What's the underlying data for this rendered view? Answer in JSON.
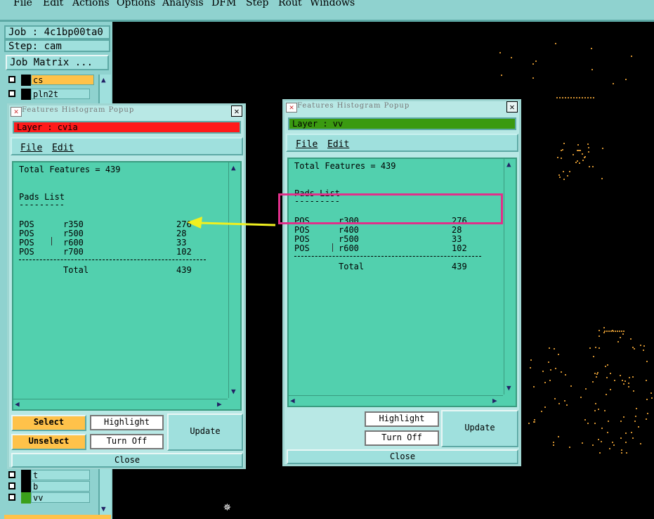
{
  "menubar": {
    "items": [
      "File",
      "Edit",
      "Actions",
      "Options",
      "Analysis",
      "DFM",
      "Step",
      "Rout",
      "Windows"
    ]
  },
  "leftpanel": {
    "job": "Job : 4c1bp00ta0",
    "step": "Step: cam",
    "job_matrix": "Job Matrix ...",
    "layers_top": [
      {
        "name": "cs",
        "color": "#ffc24a"
      },
      {
        "name": "pln2t",
        "color": "#9fe0dd"
      }
    ],
    "layers_bottom": [
      {
        "name": "t",
        "color": "#9fe0dd",
        "swatch": "#000000"
      },
      {
        "name": "b",
        "color": "#9fe0dd",
        "swatch": "#000000"
      },
      {
        "name": "vv",
        "color": "#9fe0dd",
        "swatch": "#3aa01a"
      }
    ]
  },
  "popup_left": {
    "title": "Features Histogram Popup",
    "layer_label": "Layer :  cvia",
    "layer_color": "#ff1a1a",
    "menu": {
      "file": "File",
      "edit": "Edit"
    },
    "total": "Total Features = 439",
    "list_title": "Pads List",
    "list_underline": "---------",
    "rows": [
      {
        "type": "POS",
        "sym": "r350",
        "count": "276"
      },
      {
        "type": "POS",
        "sym": "r500",
        "count": "28"
      },
      {
        "type": "POS",
        "sym": "r600",
        "count": "33"
      },
      {
        "type": "POS",
        "sym": "r700",
        "count": "102"
      }
    ],
    "total_label": "Total",
    "total_value": "439",
    "buttons": {
      "select": "Select",
      "unselect": "Unselect",
      "highlight": "Highlight",
      "turn_off": "Turn Off",
      "update": "Update",
      "close": "Close"
    }
  },
  "popup_right": {
    "title": "Features Histogram Popup",
    "layer_label": "Layer :  vv",
    "layer_color": "#3a9a10",
    "menu": {
      "file": "File",
      "edit": "Edit"
    },
    "total": "Total Features = 439",
    "list_title": "Pads List",
    "list_underline": "---------",
    "rows": [
      {
        "type": "POS",
        "sym": "r300",
        "count": "276"
      },
      {
        "type": "POS",
        "sym": "r400",
        "count": "28"
      },
      {
        "type": "POS",
        "sym": "r500",
        "count": "33"
      },
      {
        "type": "POS",
        "sym": "r600",
        "count": "102"
      }
    ],
    "total_label": "Total",
    "total_value": "439",
    "buttons": {
      "highlight": "Highlight",
      "turn_off": "Turn Off",
      "update": "Update",
      "close": "Close"
    }
  },
  "colors": {
    "menubar": "#8fd2cf",
    "text_area": "#52d0ae",
    "annotation_box": "#e0308a",
    "annotation_arrow": "#f0f020"
  }
}
